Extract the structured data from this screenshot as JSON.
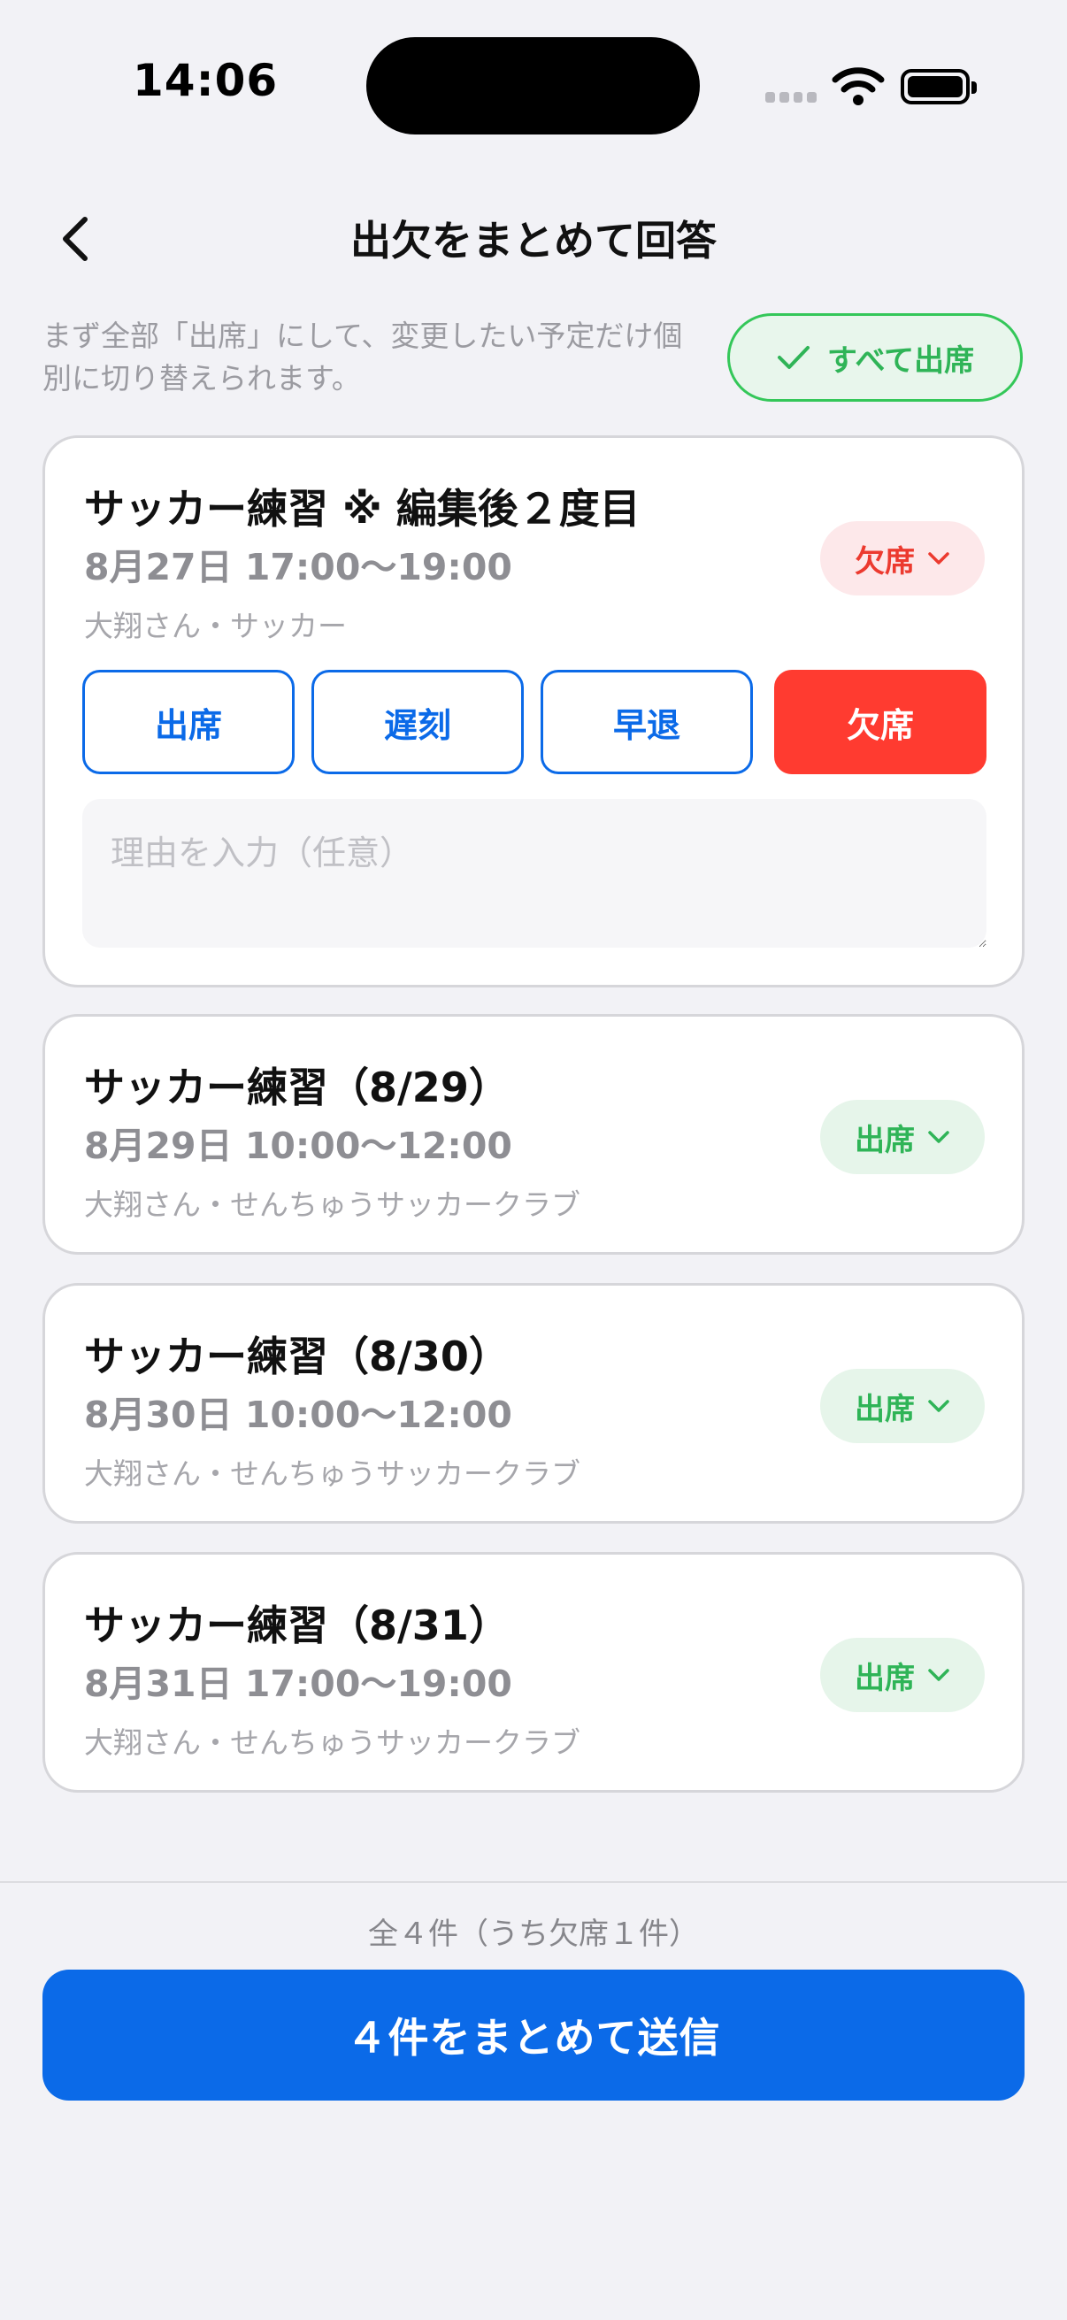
{
  "status_bar": {
    "time": "14:06"
  },
  "nav": {
    "title": "出欠をまとめて回答",
    "back_icon": "chevron-left-icon"
  },
  "intro": {
    "text": "まず全部「出席」にして、変更したい予定だけ個別に切り替えられます。",
    "all_attend_label": "すべて出席",
    "all_attend_icon": "checkmark-icon"
  },
  "colors": {
    "accent": "#0b6ae8",
    "absent": "#ff3b30",
    "attend": "#34c759"
  },
  "events": [
    {
      "title": "サッカー練習 ※ 編集後２度目",
      "date": "8月27日 17:00〜19:00",
      "sub": "大翔さん・サッカー",
      "status": "欠席",
      "expanded": true,
      "options": [
        "出席",
        "遅刻",
        "早退",
        "欠席"
      ],
      "selected_option": "欠席",
      "reason_placeholder": "理由を入力（任意）",
      "reason_value": ""
    },
    {
      "title": "サッカー練習（8/29）",
      "date": "8月29日 10:00〜12:00",
      "sub": "大翔さん・せんちゅうサッカークラブ",
      "status": "出席"
    },
    {
      "title": "サッカー練習（8/30）",
      "date": "8月30日 10:00〜12:00",
      "sub": "大翔さん・せんちゅうサッカークラブ",
      "status": "出席"
    },
    {
      "title": "サッカー練習（8/31）",
      "date": "8月31日 17:00〜19:00",
      "sub": "大翔さん・せんちゅうサッカークラブ",
      "status": "出席"
    }
  ],
  "footer": {
    "summary": "全４件（うち欠席１件）",
    "submit_label": "４件をまとめて送信"
  }
}
